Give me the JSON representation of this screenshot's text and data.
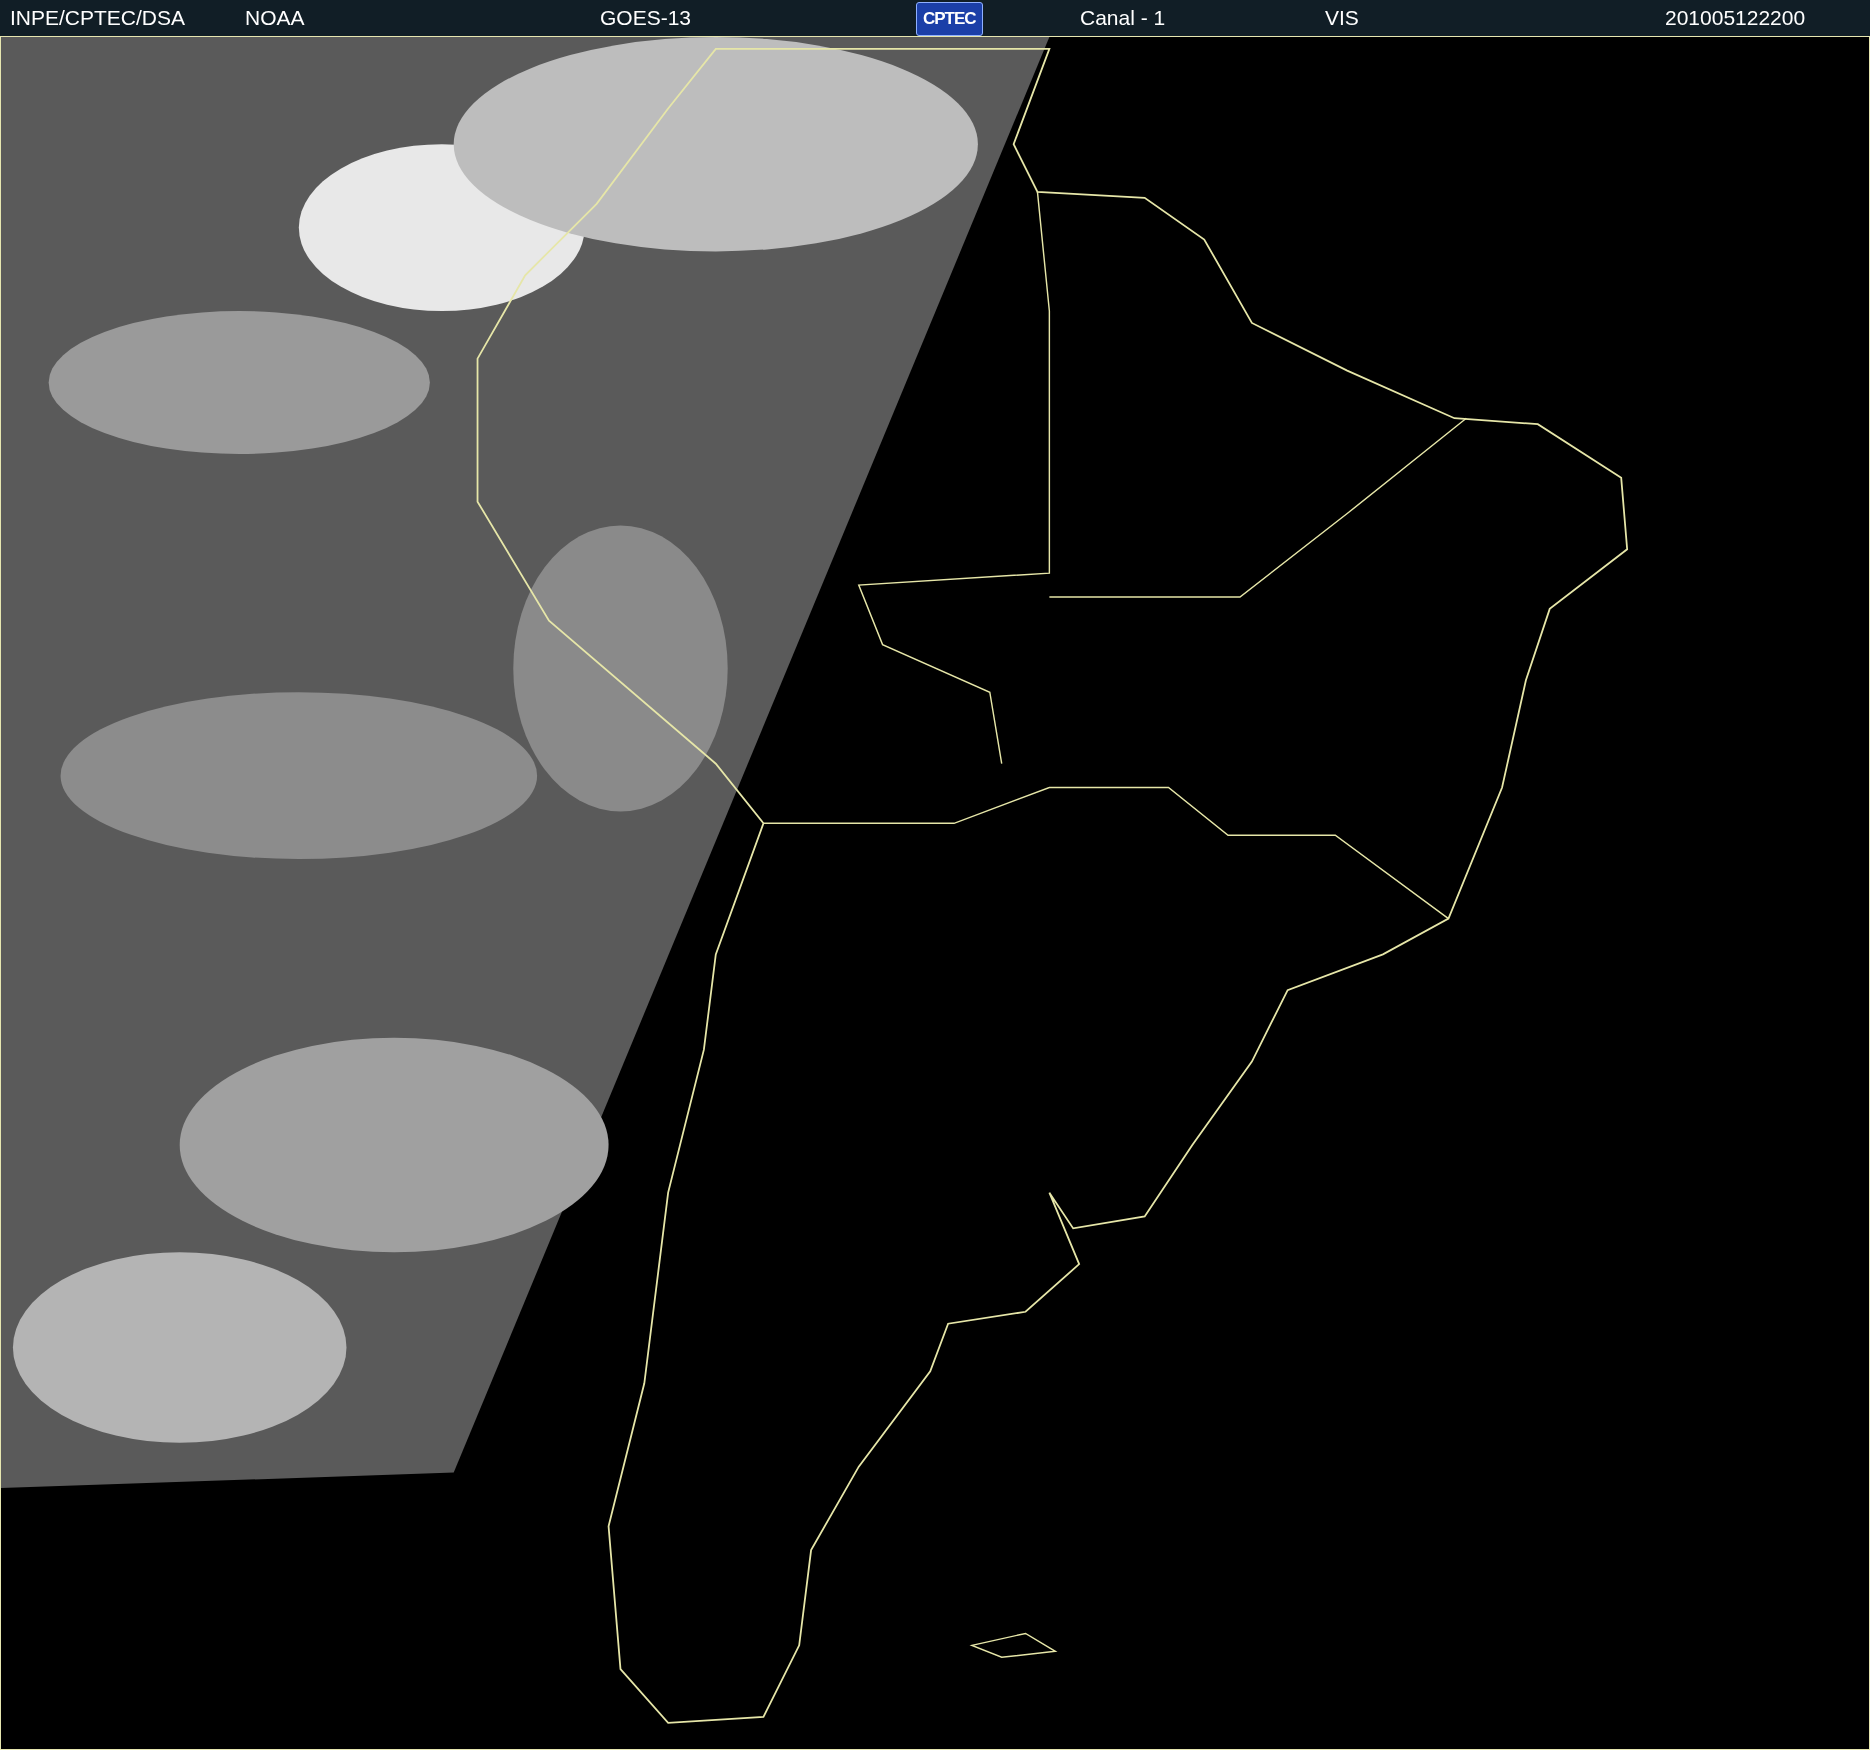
{
  "header": {
    "items": [
      {
        "kind": "text",
        "text": "INPE/CPTEC/DSA"
      },
      {
        "kind": "text",
        "text": "NOAA"
      },
      {
        "kind": "text",
        "text": "GOES-13"
      },
      {
        "kind": "logo",
        "text": "CPTEC"
      },
      {
        "kind": "text",
        "text": "Canal - 1"
      },
      {
        "kind": "text",
        "text": "VIS"
      },
      {
        "kind": "text",
        "text": "201005122200"
      }
    ]
  }
}
